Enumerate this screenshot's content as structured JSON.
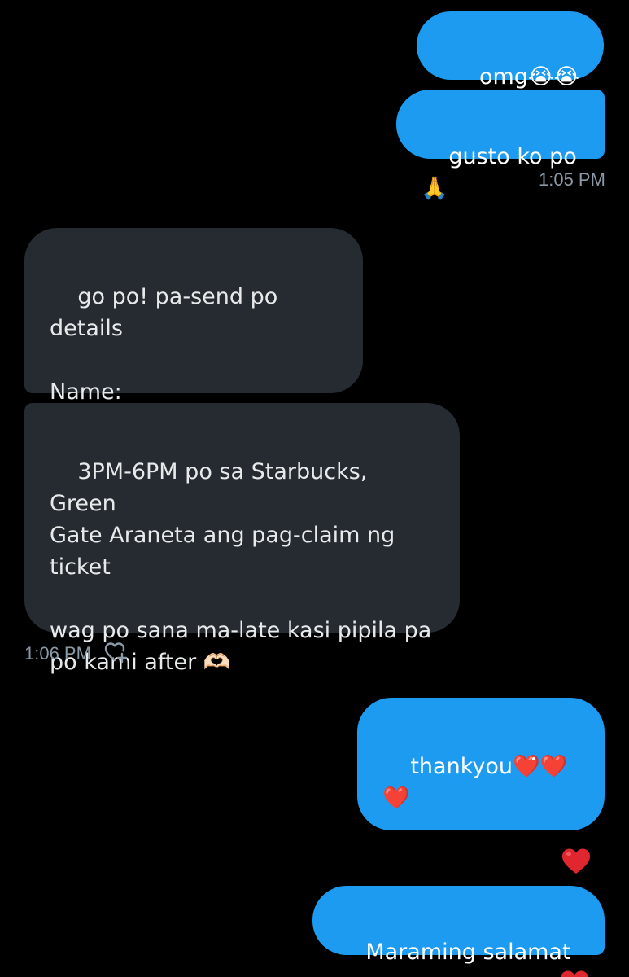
{
  "messages": {
    "m1": {
      "text": "omg😭😭😭",
      "direction": "sent"
    },
    "m2": {
      "text": "gusto ko po 🙏",
      "direction": "sent"
    },
    "t1": "1:05 PM",
    "m3": {
      "text": "go po! pa-send po details\n\nName:\nContact#",
      "direction": "received"
    },
    "m4": {
      "text": "3PM-6PM po sa Starbucks, Green\nGate Araneta ang pag-claim ng\nticket\n\nwag po sana ma-late kasi pipila pa\npo kami after 🫶🏻",
      "direction": "received"
    },
    "t2": "1:06 PM",
    "m5": {
      "text": "thankyou❤️❤️❤️",
      "direction": "sent"
    },
    "m6": {
      "text": "Maraming salamat po",
      "direction": "sent"
    }
  },
  "reactions": {
    "m5_reaction": "heart-icon"
  },
  "colors": {
    "background": "#000000",
    "sent_bubble": "#1d9bf0",
    "received_bubble": "#252b31",
    "timestamp": "#8b98a5",
    "heart": "#e0262f"
  }
}
